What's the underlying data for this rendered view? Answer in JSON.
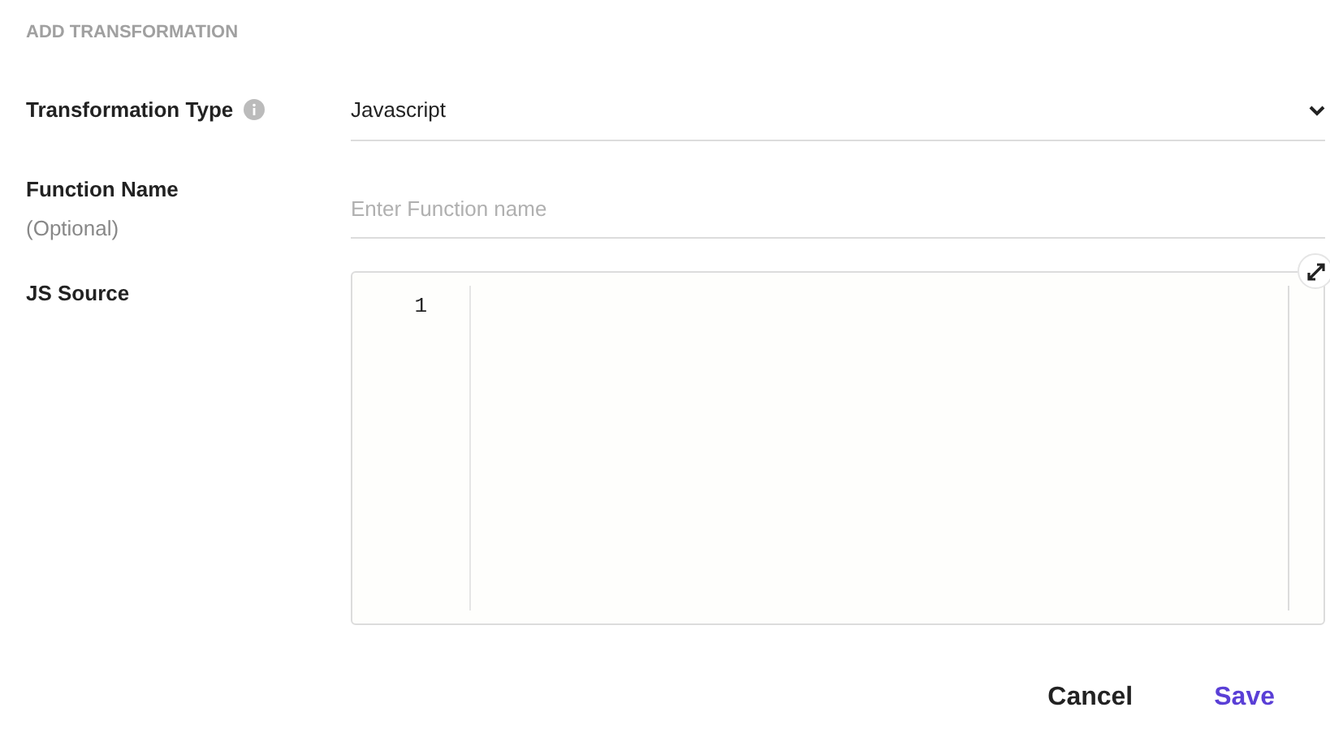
{
  "heading": "ADD TRANSFORMATION",
  "transformation_type": {
    "label": "Transformation Type",
    "value": "Javascript"
  },
  "function_name": {
    "label": "Function Name",
    "hint": "(Optional)",
    "placeholder": "Enter Function name"
  },
  "js_source": {
    "label": "JS Source",
    "line_numbers": [
      "1"
    ]
  },
  "buttons": [
    {
      "label": "Cancel",
      "kind": "secondary"
    },
    {
      "label": "Save",
      "kind": "primary"
    }
  ]
}
